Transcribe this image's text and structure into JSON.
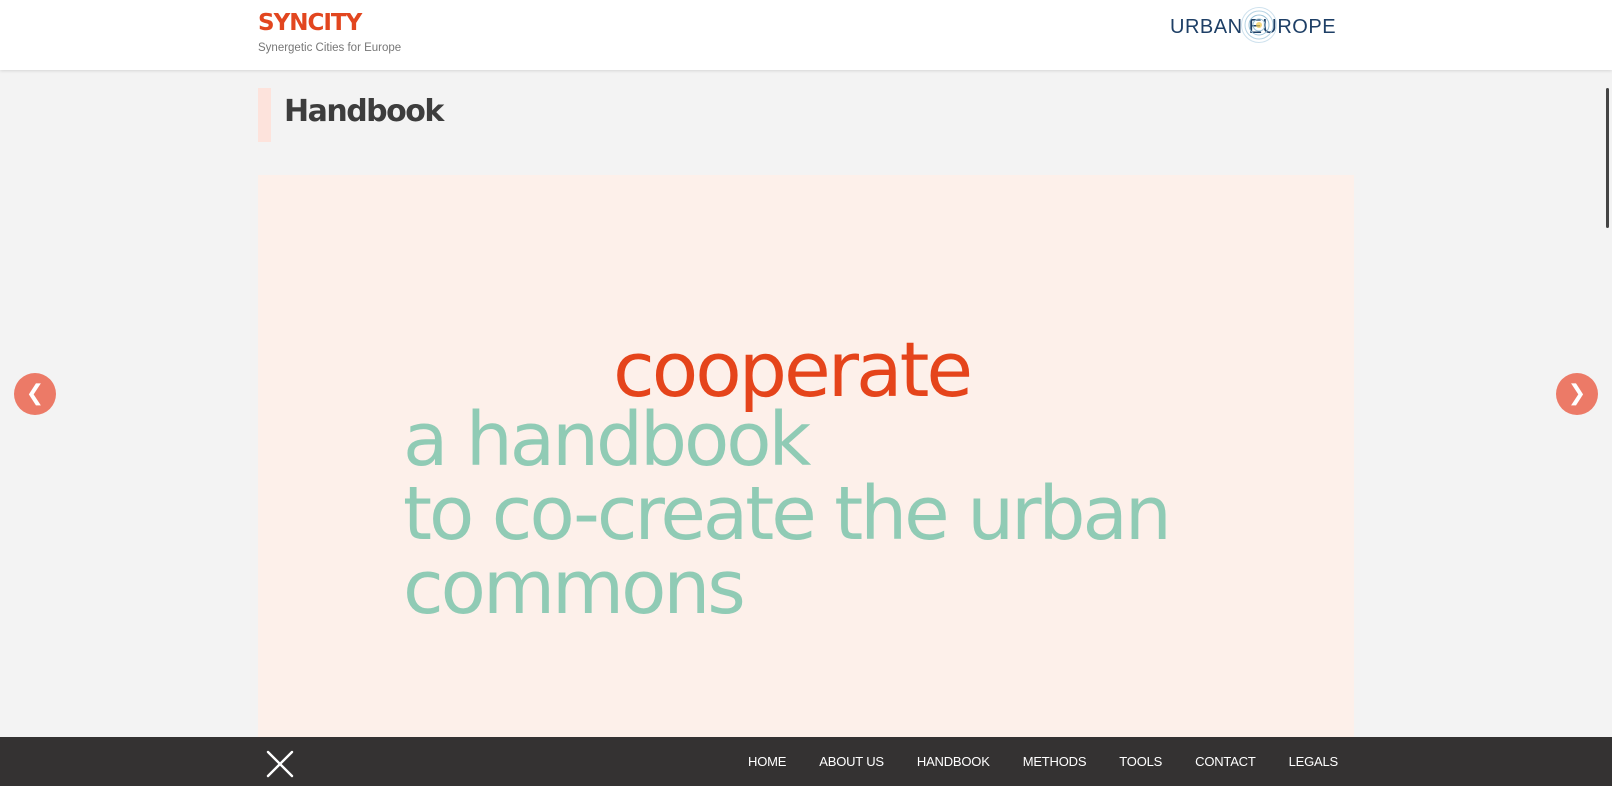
{
  "header": {
    "brand_title": "SYNCITY",
    "brand_subtitle": "Synergetic Cities for Europe",
    "partner_logo_text": "URBAN EUROPE"
  },
  "page": {
    "title": "Handbook"
  },
  "slider": {
    "slide": {
      "accent_word": "cooperate",
      "lines": [
        "a handbook",
        "to co-create the urban",
        "commons"
      ]
    },
    "prev_label": "❮",
    "next_label": "❯"
  },
  "footer": {
    "nav": [
      {
        "label": "HOME"
      },
      {
        "label": "ABOUT US"
      },
      {
        "label": "HANDBOOK"
      },
      {
        "label": "METHODS"
      },
      {
        "label": "TOOLS"
      },
      {
        "label": "CONTACT"
      },
      {
        "label": "LEGALS"
      }
    ]
  },
  "colors": {
    "brand_accent": "#e2461f",
    "slide_accent": "#e5441b",
    "slide_text": "#90cbb5",
    "slide_background": "#fdf0ea",
    "arrow": "#ec7a67",
    "footer_background": "#343232"
  },
  "icons": {
    "close": "close-icon",
    "prev": "chevron-left-icon",
    "next": "chevron-right-icon"
  }
}
